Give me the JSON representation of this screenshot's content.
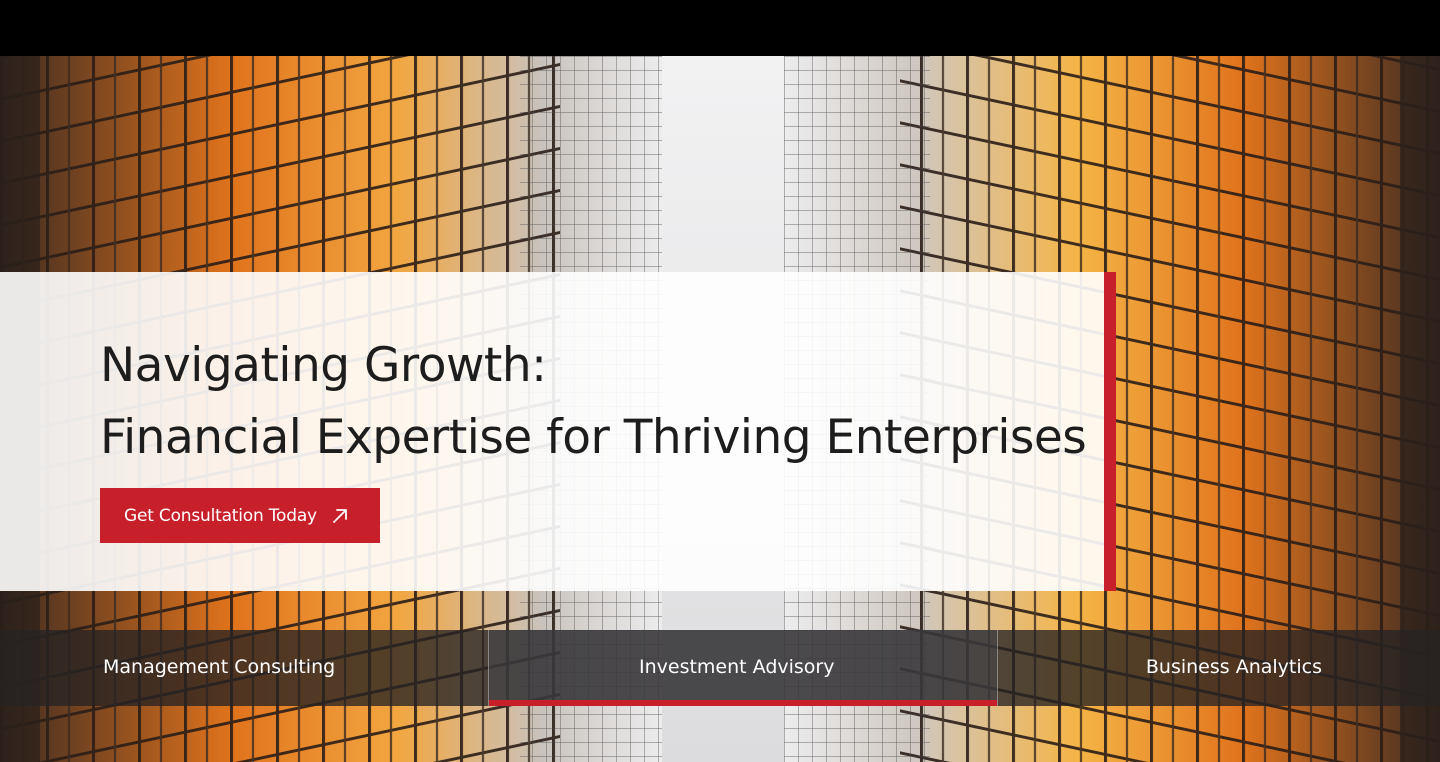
{
  "hero": {
    "headline_line1": "Navigating Growth:",
    "headline_line2": "Financial Expertise for Thriving Enterprises",
    "cta_label": "Get Consultation Today",
    "cta_icon": "arrow-up-right-icon"
  },
  "tabs": [
    {
      "label": "Management Consulting",
      "active": false
    },
    {
      "label": "Investment Advisory",
      "active": true
    },
    {
      "label": "Business Analytics",
      "active": false
    }
  ],
  "colors": {
    "accent": "#c8202b",
    "headline": "#1d1d1d",
    "tab_bar": "#262222"
  }
}
